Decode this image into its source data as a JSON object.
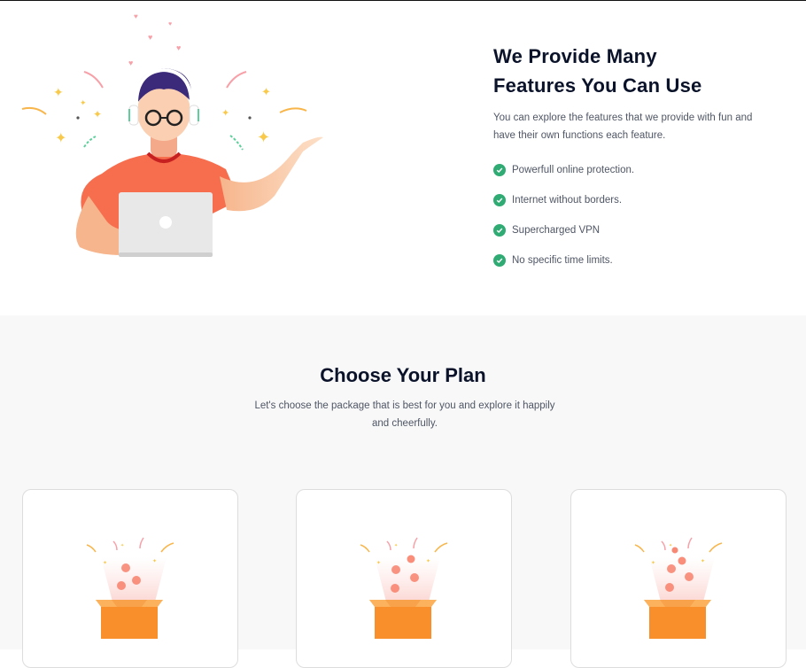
{
  "features": {
    "title_line1": "We Provide Many",
    "title_line2": "Features You Can Use",
    "description": "You can explore the features that we provide with fun and have their own functions each feature.",
    "items": [
      {
        "label": "Powerfull online protection."
      },
      {
        "label": "Internet without borders."
      },
      {
        "label": "Supercharged VPN"
      },
      {
        "label": "No specific time limits."
      }
    ]
  },
  "plans": {
    "title": "Choose Your Plan",
    "description": "Let's choose the package that is best for you and explore it happily and cheerfully."
  },
  "colors": {
    "check_green": "#2fab73",
    "heading": "#0b132a",
    "body_text": "#4f5665",
    "plans_bg": "#f8f8f8",
    "box_orange": "#f99a3c",
    "shirt_orange": "#f76e4f"
  },
  "icons": [
    "check-circle-icon",
    "gift-box-icon"
  ]
}
